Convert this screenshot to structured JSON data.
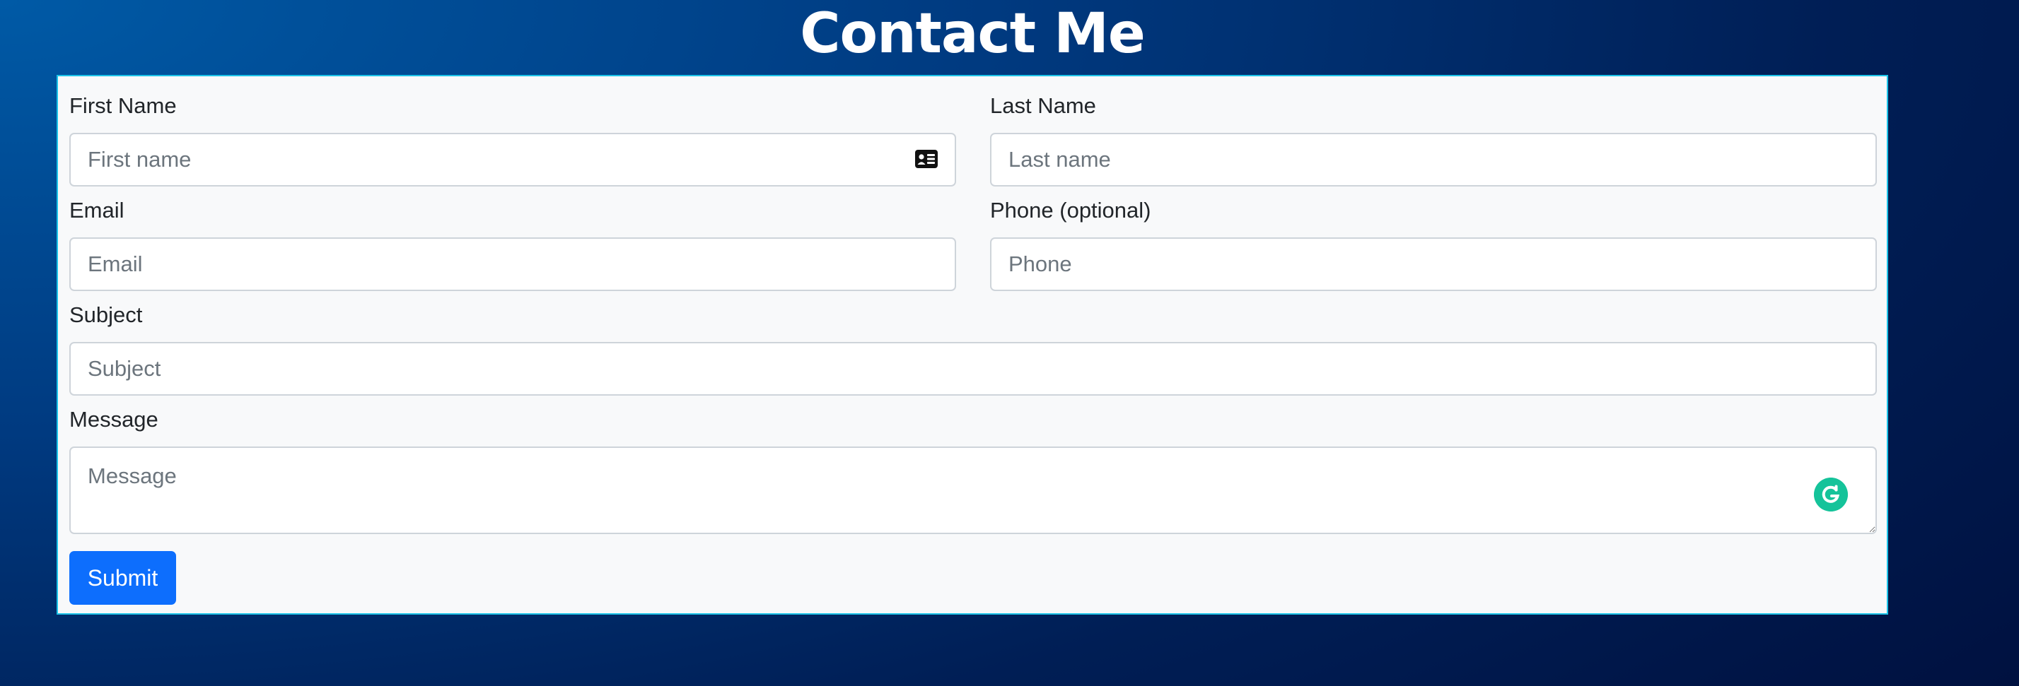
{
  "page": {
    "title": "Contact Me"
  },
  "form": {
    "first_name": {
      "label": "First Name",
      "placeholder": "First name",
      "value": ""
    },
    "last_name": {
      "label": "Last Name",
      "placeholder": "Last name",
      "value": ""
    },
    "email": {
      "label": "Email",
      "placeholder": "Email",
      "value": ""
    },
    "phone": {
      "label": "Phone (optional)",
      "placeholder": "Phone",
      "value": ""
    },
    "subject": {
      "label": "Subject",
      "placeholder": "Subject",
      "value": ""
    },
    "message": {
      "label": "Message",
      "placeholder": "Message",
      "value": ""
    },
    "submit_label": "Submit"
  },
  "icons": {
    "autofill": "contact-card-icon",
    "grammar": "grammarly-icon"
  },
  "colors": {
    "primary_button": "#0d6efd",
    "card_border": "#1cc3e8",
    "card_background": "#f8f9fa",
    "grammarly_green": "#15c39a"
  }
}
